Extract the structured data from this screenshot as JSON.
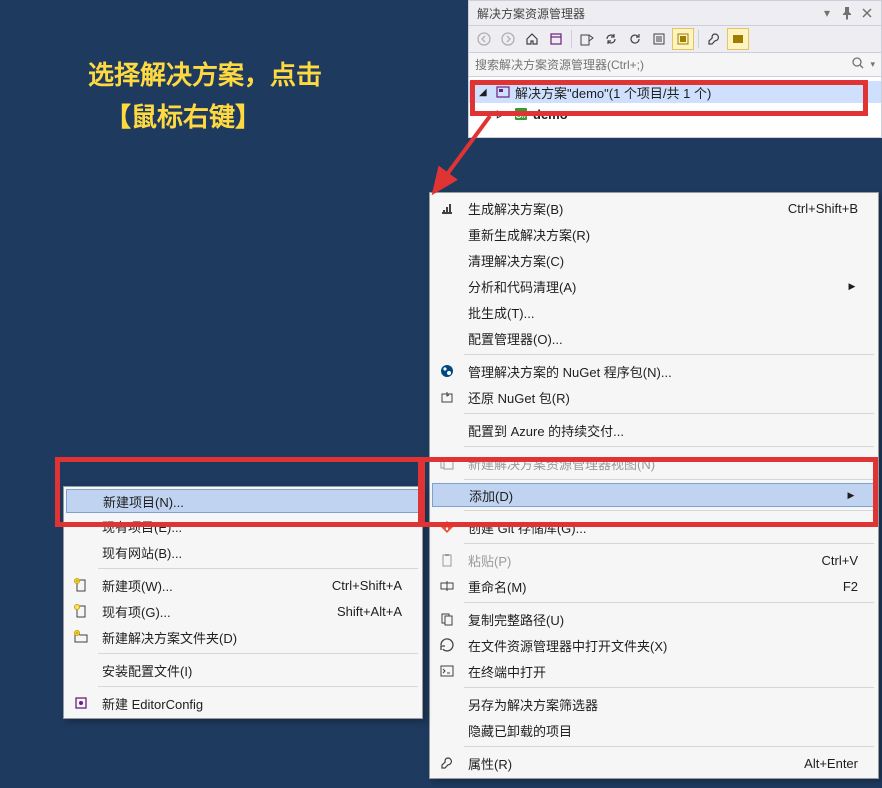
{
  "annotation": {
    "line1": "选择解决方案，点击",
    "line2": "【鼠标右键】"
  },
  "panel": {
    "title": "解决方案资源管理器",
    "search_placeholder": "搜索解决方案资源管理器(Ctrl+;)",
    "tree": {
      "solution": "解决方案\"demo\"(1 个项目/共 1 个)",
      "project": "demo"
    }
  },
  "main_menu": {
    "items": [
      {
        "label": "生成解决方案(B)",
        "shortcut": "Ctrl+Shift+B",
        "icon": "build"
      },
      {
        "label": "重新生成解决方案(R)"
      },
      {
        "label": "清理解决方案(C)"
      },
      {
        "label": "分析和代码清理(A)",
        "submenu": true
      },
      {
        "label": "批生成(T)..."
      },
      {
        "label": "配置管理器(O)..."
      },
      {
        "sep": true
      },
      {
        "label": "管理解决方案的 NuGet 程序包(N)...",
        "icon": "nuget"
      },
      {
        "label": "还原 NuGet 包(R)",
        "icon": "restore"
      },
      {
        "sep": true
      },
      {
        "label": "配置到 Azure 的持续交付..."
      },
      {
        "sep": true
      },
      {
        "label": "新建解决方案资源管理器视图(N)",
        "icon": "newview",
        "disabled": true
      },
      {
        "sep": true
      },
      {
        "label": "添加(D)",
        "submenu": true,
        "highlight": true
      },
      {
        "sep": true
      },
      {
        "label": "创建 Git 存储库(G)...",
        "icon": "git"
      },
      {
        "sep": true
      },
      {
        "label": "粘贴(P)",
        "shortcut": "Ctrl+V",
        "icon": "paste",
        "disabled": true
      },
      {
        "label": "重命名(M)",
        "shortcut": "F2",
        "icon": "rename"
      },
      {
        "sep": true
      },
      {
        "label": "复制完整路径(U)",
        "icon": "copy"
      },
      {
        "label": "在文件资源管理器中打开文件夹(X)",
        "icon": "openfolder"
      },
      {
        "label": "在终端中打开",
        "icon": "terminal"
      },
      {
        "sep": true
      },
      {
        "label": "另存为解决方案筛选器"
      },
      {
        "label": "隐藏已卸载的项目"
      },
      {
        "sep": true
      },
      {
        "label": "属性(R)",
        "shortcut": "Alt+Enter",
        "icon": "wrench"
      }
    ]
  },
  "sub_menu": {
    "items": [
      {
        "label": "新建项目(N)...",
        "highlight": true
      },
      {
        "label": "现有项目(E)..."
      },
      {
        "label": "现有网站(B)..."
      },
      {
        "sep": true
      },
      {
        "label": "新建项(W)...",
        "shortcut": "Ctrl+Shift+A",
        "icon": "newitem"
      },
      {
        "label": "现有项(G)...",
        "shortcut": "Shift+Alt+A",
        "icon": "existitem"
      },
      {
        "label": "新建解决方案文件夹(D)",
        "icon": "newfolder"
      },
      {
        "sep": true
      },
      {
        "label": "安装配置文件(I)"
      },
      {
        "sep": true
      },
      {
        "label": "新建 EditorConfig",
        "icon": "editorconfig"
      }
    ]
  }
}
